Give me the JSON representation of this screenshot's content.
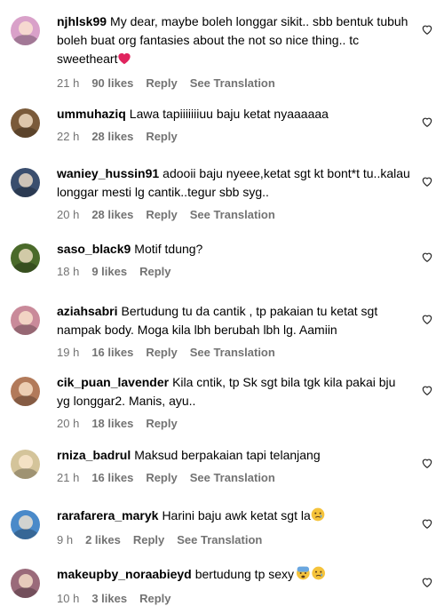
{
  "labels": {
    "reply": "Reply",
    "translate": "See Translation"
  },
  "comments": [
    {
      "user": "njhlsk99",
      "text": "My dear, maybe boleh longgar sikit.. sbb bentuk tubuh boleh buat org fantasies about the not so nice thing.. tc sweetheart",
      "emoji": "red-heart",
      "time": "21 h",
      "likes": "90 likes",
      "translation": true
    },
    {
      "user": "ummuhaziq",
      "text": "Lawa tapiiiiiiiuu baju ketat nyaaaaaa",
      "time": "22 h",
      "likes": "28 likes",
      "translation": false
    },
    {
      "user": "waniey_hussin91",
      "text": "adooii baju nyeee,ketat sgt kt bont*t tu..kalau longgar mesti lg cantik..tegur sbb syg..",
      "time": "20 h",
      "likes": "28 likes",
      "translation": true
    },
    {
      "user": "saso_black9",
      "text": "Motif tdung?",
      "time": "18 h",
      "likes": "9 likes",
      "translation": false
    },
    {
      "user": "aziahsabri",
      "text": "Bertudung tu da cantik , tp pakaian tu ketat sgt nampak body. Moga kila lbh berubah lbh lg. Aamiin",
      "time": "19 h",
      "likes": "16 likes",
      "translation": true
    },
    {
      "user": "cik_puan_lavender",
      "text": "Kila cntik, tp Sk sgt bila tgk kila pakai bju yg longgar2. Manis, ayu..",
      "time": "20 h",
      "likes": "18 likes",
      "translation": false
    },
    {
      "user": "rniza_badrul",
      "text": "Maksud berpakaian tapi telanjang",
      "time": "21 h",
      "likes": "16 likes",
      "translation": true
    },
    {
      "user": "rarafarera_maryk",
      "text": "Harini baju awk ketat sgt la",
      "emoji": "sad-face",
      "time": "9 h",
      "likes": "2 likes",
      "translation": true
    },
    {
      "user": "makeupby_noraabieyd",
      "text": "bertudung tp sexy",
      "emoji": "fear-sad-face",
      "time": "10 h",
      "likes": "3 likes",
      "translation": false
    }
  ],
  "avatar_colors": [
    "#d9a1c9",
    "#7a5a3a",
    "#3a4e6e",
    "#4a6a2a",
    "#c98a9a",
    "#b27a5a",
    "#d4c49a",
    "#4a8ac9",
    "#9a6a7a"
  ]
}
